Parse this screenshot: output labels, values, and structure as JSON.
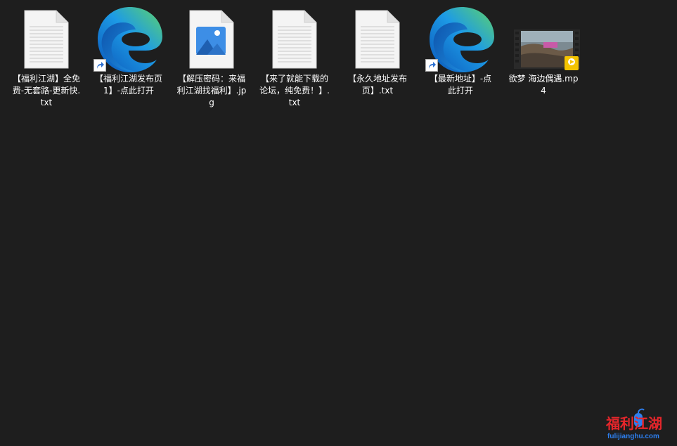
{
  "desktop": {
    "background": "#1e1e1e",
    "items": [
      {
        "label": "【福利江湖】全免费-无套路-更新快.txt",
        "icon": "text-document-icon"
      },
      {
        "label": "【福利江湖发布页1】-点此打开",
        "icon": "edge-shortcut-icon"
      },
      {
        "label": "【解压密码：来福利江湖找福利】.jpg",
        "icon": "image-file-icon"
      },
      {
        "label": "【来了就能下载的论坛，纯免费！】.txt",
        "icon": "text-document-icon"
      },
      {
        "label": "【永久地址发布页】.txt",
        "icon": "text-document-icon"
      },
      {
        "label": "【最新地址】-点此打开",
        "icon": "edge-shortcut-icon"
      },
      {
        "label": "欲梦 海边偶遇.mp4",
        "icon": "video-file-icon"
      }
    ]
  },
  "watermark": {
    "title": "福利江湖",
    "url": "fulijianghu.com"
  },
  "colors": {
    "edge_blue": "#0f6fd6",
    "edge_green": "#5fd36a",
    "label_text": "#ffffff",
    "watermark_red": "#e5262b",
    "watermark_blue": "#2d7ff0"
  }
}
